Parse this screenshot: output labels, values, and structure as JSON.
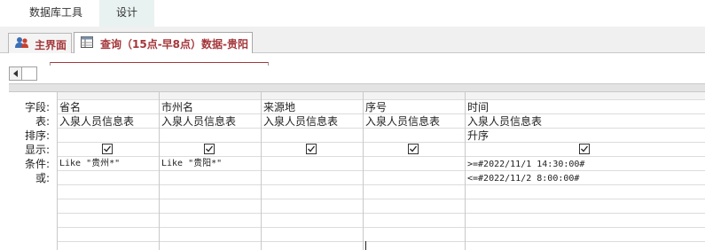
{
  "ribbon": {
    "tabs": [
      {
        "label": "数据库工具"
      },
      {
        "label": "设计"
      }
    ]
  },
  "doc_tabs": {
    "home": {
      "label": "主界面",
      "icon": "people-icon"
    },
    "query": {
      "label": "查询（15点-早8点）数据-贵阳",
      "icon": "query-icon"
    }
  },
  "accent_color": "#a4373a",
  "qbe": {
    "row_labels": {
      "field": "字段:",
      "table": "表:",
      "sort": "排序:",
      "show": "显示:",
      "criteria": "条件:",
      "or": "或:"
    },
    "columns": [
      {
        "field": "省名",
        "table": "入泉人员信息表",
        "sort": "",
        "show": true,
        "criteria": "Like \"贵州*\"",
        "or": ""
      },
      {
        "field": "市州名",
        "table": "入泉人员信息表",
        "sort": "",
        "show": true,
        "criteria": "Like \"贵阳*\"",
        "or": ""
      },
      {
        "field": "来源地",
        "table": "入泉人员信息表",
        "sort": "",
        "show": true,
        "criteria": "",
        "or": ""
      },
      {
        "field": "序号",
        "table": "入泉人员信息表",
        "sort": "",
        "show": true,
        "criteria": "",
        "or": ""
      },
      {
        "field": "时间",
        "table": "入泉人员信息表",
        "sort": "升序",
        "show": true,
        "criteria": ">=#2022/11/1 14:30:00#",
        "or": "<=#2022/11/2 8:00:00#"
      }
    ]
  }
}
